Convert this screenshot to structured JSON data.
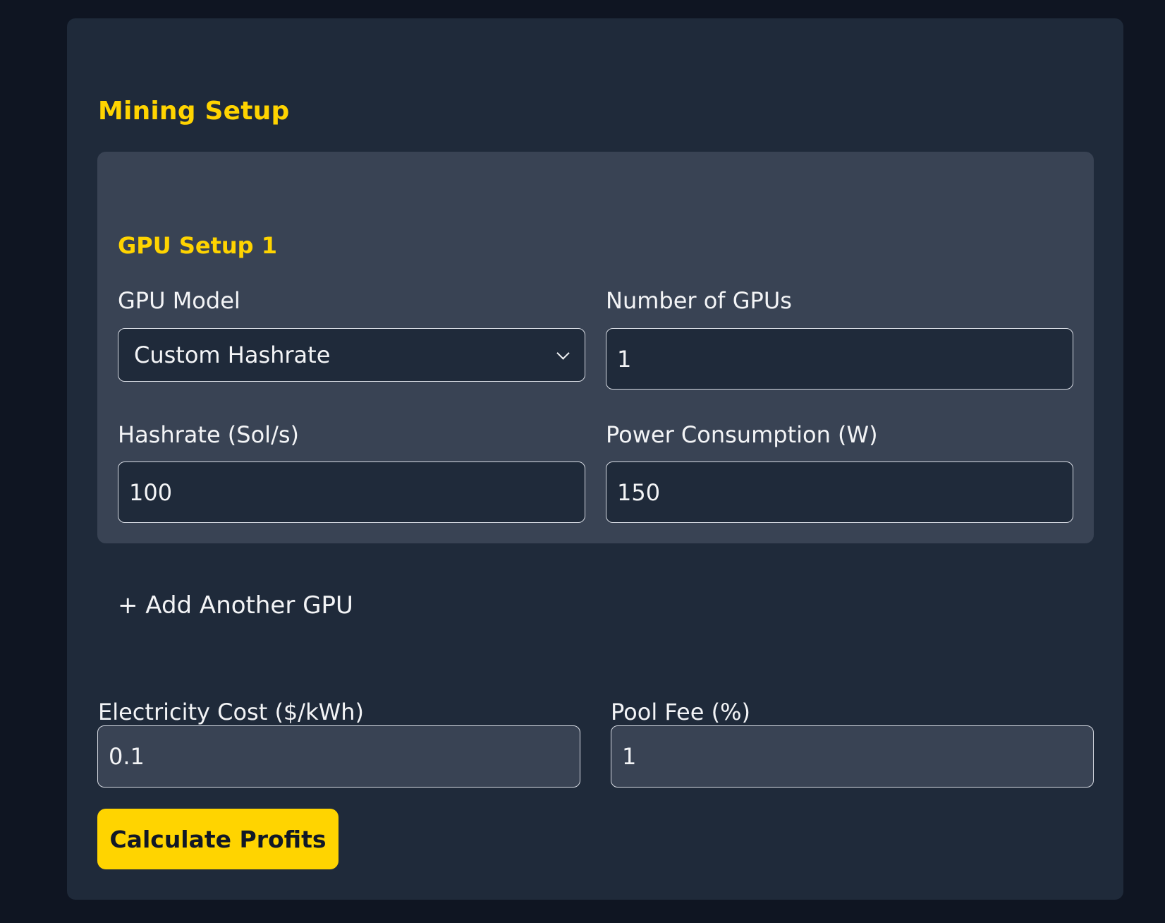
{
  "mining_setup": {
    "title": "Mining Setup",
    "gpu_setup": {
      "title": "GPU Setup 1",
      "gpu_model": {
        "label": "GPU Model",
        "value": "Custom Hashrate"
      },
      "number_of_gpus": {
        "label": "Number of GPUs",
        "value": "1"
      },
      "hashrate": {
        "label": "Hashrate (Sol/s)",
        "value": "100"
      },
      "power_consumption": {
        "label": "Power Consumption (W)",
        "value": "150"
      }
    },
    "add_gpu_label": "+ Add Another GPU",
    "electricity_cost": {
      "label": "Electricity Cost ($/kWh)",
      "value": "0.1"
    },
    "pool_fee": {
      "label": "Pool Fee (%)",
      "value": "1"
    },
    "calculate_label": "Calculate Profits"
  },
  "colors": {
    "accent": "#ffd400",
    "page_background": "#0f1522",
    "card_background": "#1f2a3a",
    "gpu_box_background": "#394354"
  },
  "icons": {
    "gpu_model_dropdown": "chevron-down-icon"
  }
}
